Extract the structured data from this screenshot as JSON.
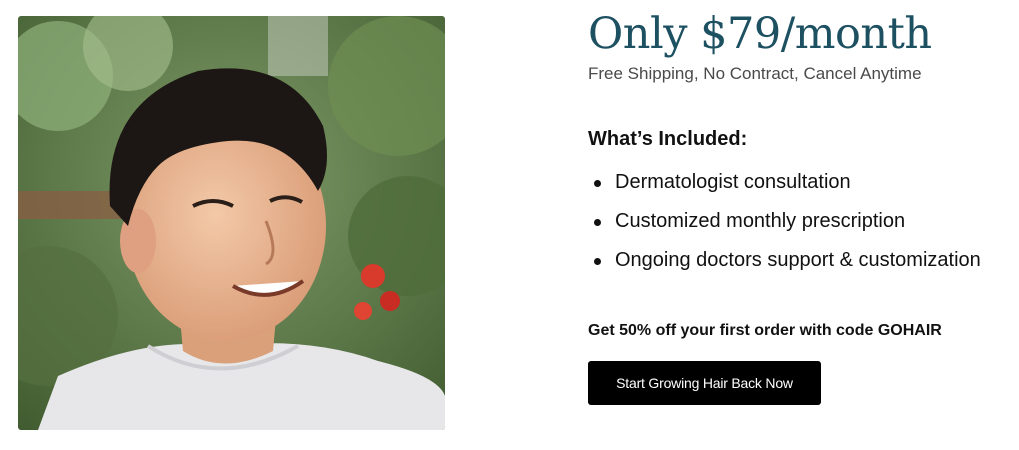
{
  "pricing": {
    "headline": "Only $79/month",
    "subline": "Free Shipping, No Contract, Cancel Anytime"
  },
  "included": {
    "title": "What’s Included:",
    "items": [
      {
        "label": "Dermatologist consultation"
      },
      {
        "label": "Customized monthly prescription"
      },
      {
        "label": "Ongoing doctors support & customization"
      }
    ]
  },
  "promo": {
    "text": "Get 50% off your first order with code GOHAIR"
  },
  "cta": {
    "label": "Start Growing Hair Back Now"
  },
  "colors": {
    "headline": "#1d5162",
    "button_bg": "#000000",
    "button_text": "#ffffff"
  }
}
